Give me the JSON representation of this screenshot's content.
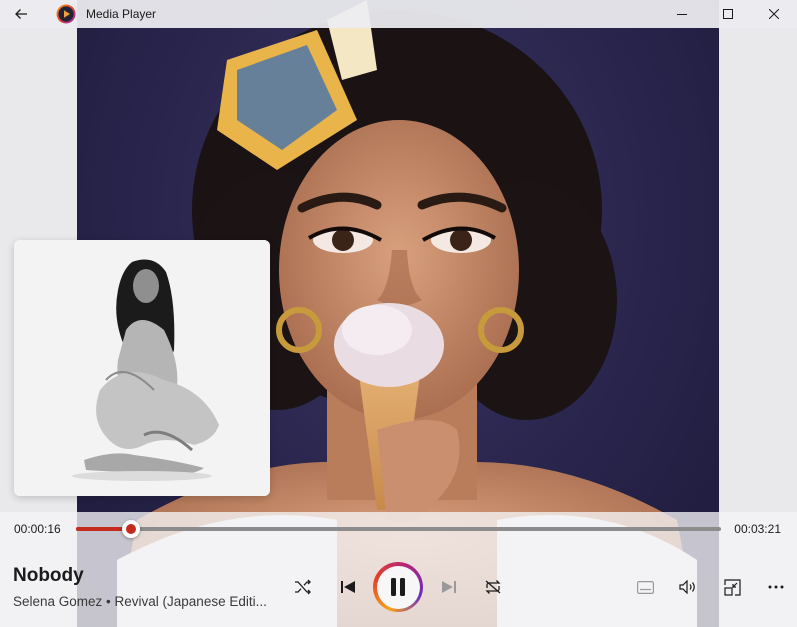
{
  "window": {
    "title": "Media Player"
  },
  "playback": {
    "elapsed": "00:00:16",
    "total": "00:03:21",
    "progress_fraction": 0.086
  },
  "track": {
    "title": "Nobody",
    "subtitle": "Selena Gomez • Revival (Japanese Editi..."
  },
  "colors": {
    "accent": "#c42b1c",
    "titlebar_bg": "#ececf0",
    "hero_bg": "#27234a"
  },
  "icons": {
    "back": "back-arrow-icon",
    "app": "media-player-app-icon",
    "minimize": "minimize-icon",
    "maximize": "maximize-icon",
    "close": "close-icon",
    "shuffle": "shuffle-icon",
    "previous": "previous-track-icon",
    "play_pause": "pause-icon",
    "next": "next-track-icon",
    "repeat": "repeat-icon",
    "captions": "captions-icon",
    "volume": "volume-icon",
    "mini_player": "mini-player-icon",
    "more": "more-options-icon"
  }
}
